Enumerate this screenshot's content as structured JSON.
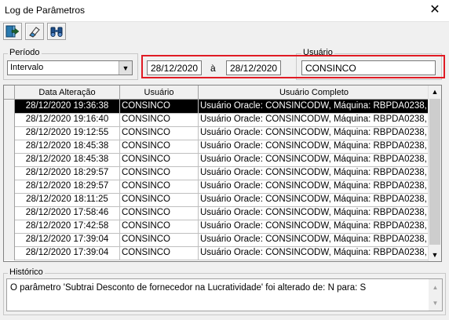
{
  "window": {
    "title": "Log de Parâmetros",
    "close_glyph": "✕"
  },
  "toolbar": [
    {
      "icon": "exit-icon"
    },
    {
      "icon": "eraser-icon"
    },
    {
      "icon": "binoculars-icon"
    }
  ],
  "filters": {
    "period_label": "Período",
    "period_value": "Intervalo",
    "date_from": "28/12/2020",
    "date_sep": "à",
    "date_to": "28/12/2020",
    "user_label": "Usuário",
    "user_value": "CONSINCO"
  },
  "grid": {
    "columns": [
      "Data Alteração",
      "Usuário",
      "Usuário Completo"
    ],
    "rows": [
      {
        "date": "28/12/2020 19:36:38",
        "user": "CONSINCO",
        "full": "Usuário Oracle: CONSINCODW, Máquina: RBPDA0238, U",
        "selected": true
      },
      {
        "date": "28/12/2020 19:16:40",
        "user": "CONSINCO",
        "full": "Usuário Oracle: CONSINCODW, Máquina: RBPDA0238, U"
      },
      {
        "date": "28/12/2020 19:12:55",
        "user": "CONSINCO",
        "full": "Usuário Oracle: CONSINCODW, Máquina: RBPDA0238, U"
      },
      {
        "date": "28/12/2020 18:45:38",
        "user": "CONSINCO",
        "full": "Usuário Oracle: CONSINCODW, Máquina: RBPDA0238, U"
      },
      {
        "date": "28/12/2020 18:45:38",
        "user": "CONSINCO",
        "full": "Usuário Oracle: CONSINCODW, Máquina: RBPDA0238, U"
      },
      {
        "date": "28/12/2020 18:29:57",
        "user": "CONSINCO",
        "full": "Usuário Oracle: CONSINCODW, Máquina: RBPDA0238, U"
      },
      {
        "date": "28/12/2020 18:29:57",
        "user": "CONSINCO",
        "full": "Usuário Oracle: CONSINCODW, Máquina: RBPDA0238, U"
      },
      {
        "date": "28/12/2020 18:11:25",
        "user": "CONSINCO",
        "full": "Usuário Oracle: CONSINCODW, Máquina: RBPDA0238, U"
      },
      {
        "date": "28/12/2020 17:58:46",
        "user": "CONSINCO",
        "full": "Usuário Oracle: CONSINCODW, Máquina: RBPDA0238, U"
      },
      {
        "date": "28/12/2020 17:42:58",
        "user": "CONSINCO",
        "full": "Usuário Oracle: CONSINCODW, Máquina: RBPDA0238, U"
      },
      {
        "date": "28/12/2020 17:39:04",
        "user": "CONSINCO",
        "full": "Usuário Oracle: CONSINCODW, Máquina: RBPDA0238, U"
      },
      {
        "date": "28/12/2020 17:39:04",
        "user": "CONSINCO",
        "full": "Usuário Oracle: CONSINCODW, Máquina: RBPDA0238, U"
      }
    ]
  },
  "history": {
    "label": "Histórico",
    "text": "O parâmetro 'Subtrai Desconto de fornecedor na Lucratividade' foi alterado de: N para: S"
  },
  "colors": {
    "highlight_box": "#e01b24",
    "selected_row_bg": "#000000",
    "selected_row_fg": "#ffffff"
  }
}
